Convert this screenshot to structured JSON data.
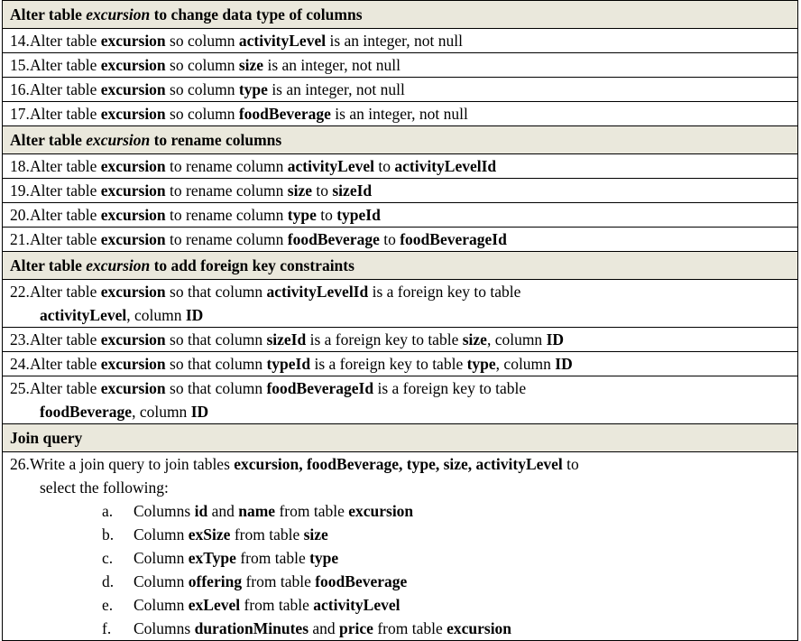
{
  "document": {
    "type": "requirements-table",
    "colors": {
      "section_header_background": "#eae8dc",
      "row_background": "#ffffff",
      "border": "#000000",
      "text": "#000000"
    },
    "sections": [
      {
        "header": {
          "prefix": "Alter table ",
          "italic": "excursion",
          "suffix": " to change data type of columns"
        },
        "items": [
          {
            "number": "14.",
            "lines": [
              [
                {
                  "t": "Alter table ",
                  "b": false
                },
                {
                  "t": "excursion",
                  "b": true
                },
                {
                  "t": " so column ",
                  "b": false
                },
                {
                  "t": "activityLevel",
                  "b": true
                },
                {
                  "t": " is an integer, not null",
                  "b": false
                }
              ]
            ]
          },
          {
            "number": "15.",
            "lines": [
              [
                {
                  "t": "Alter table ",
                  "b": false
                },
                {
                  "t": "excursion",
                  "b": true
                },
                {
                  "t": " so column ",
                  "b": false
                },
                {
                  "t": "size",
                  "b": true
                },
                {
                  "t": " is an integer, not null",
                  "b": false
                }
              ]
            ]
          },
          {
            "number": "16.",
            "lines": [
              [
                {
                  "t": "Alter table ",
                  "b": false
                },
                {
                  "t": "excursion",
                  "b": true
                },
                {
                  "t": " so column ",
                  "b": false
                },
                {
                  "t": "type",
                  "b": true
                },
                {
                  "t": " is an integer, not null",
                  "b": false
                }
              ]
            ]
          },
          {
            "number": "17.",
            "lines": [
              [
                {
                  "t": "Alter table ",
                  "b": false
                },
                {
                  "t": "excursion",
                  "b": true
                },
                {
                  "t": " so column ",
                  "b": false
                },
                {
                  "t": "foodBeverage",
                  "b": true
                },
                {
                  "t": " is an integer, not null",
                  "b": false
                }
              ]
            ]
          }
        ]
      },
      {
        "header": {
          "prefix": "Alter table ",
          "italic": "excursion",
          "suffix": " to rename columns"
        },
        "items": [
          {
            "number": "18.",
            "lines": [
              [
                {
                  "t": "Alter table ",
                  "b": false
                },
                {
                  "t": "excursion",
                  "b": true
                },
                {
                  "t": " to rename column ",
                  "b": false
                },
                {
                  "t": "activityLevel",
                  "b": true
                },
                {
                  "t": " to ",
                  "b": false
                },
                {
                  "t": "activityLevelId",
                  "b": true
                }
              ]
            ]
          },
          {
            "number": "19.",
            "lines": [
              [
                {
                  "t": "Alter table ",
                  "b": false
                },
                {
                  "t": "excursion",
                  "b": true
                },
                {
                  "t": " to rename column ",
                  "b": false
                },
                {
                  "t": "size",
                  "b": true
                },
                {
                  "t": " to ",
                  "b": false
                },
                {
                  "t": "sizeId",
                  "b": true
                }
              ]
            ]
          },
          {
            "number": "20.",
            "lines": [
              [
                {
                  "t": "Alter table ",
                  "b": false
                },
                {
                  "t": "excursion",
                  "b": true
                },
                {
                  "t": " to rename column ",
                  "b": false
                },
                {
                  "t": "type",
                  "b": true
                },
                {
                  "t": " to ",
                  "b": false
                },
                {
                  "t": "typeId",
                  "b": true
                }
              ]
            ]
          },
          {
            "number": "21.",
            "lines": [
              [
                {
                  "t": "Alter table ",
                  "b": false
                },
                {
                  "t": "excursion",
                  "b": true
                },
                {
                  "t": " to rename column ",
                  "b": false
                },
                {
                  "t": "foodBeverage",
                  "b": true
                },
                {
                  "t": " to ",
                  "b": false
                },
                {
                  "t": "foodBeverageId",
                  "b": true
                }
              ]
            ]
          }
        ]
      },
      {
        "header": {
          "prefix": "Alter table ",
          "italic": "excursion",
          "suffix": " to add foreign key constraints"
        },
        "items": [
          {
            "number": "22.",
            "lines": [
              [
                {
                  "t": "Alter table ",
                  "b": false
                },
                {
                  "t": "excursion",
                  "b": true
                },
                {
                  "t": " so that column ",
                  "b": false
                },
                {
                  "t": "activityLevelId",
                  "b": true
                },
                {
                  "t": " is a foreign key to table",
                  "b": false
                }
              ],
              [
                {
                  "t": "activityLevel",
                  "b": true
                },
                {
                  "t": ", column ",
                  "b": false
                },
                {
                  "t": "ID",
                  "b": true
                }
              ]
            ]
          },
          {
            "number": "23.",
            "lines": [
              [
                {
                  "t": "Alter table ",
                  "b": false
                },
                {
                  "t": "excursion",
                  "b": true
                },
                {
                  "t": " so that column ",
                  "b": false
                },
                {
                  "t": "sizeId",
                  "b": true
                },
                {
                  "t": " is a foreign key to table ",
                  "b": false
                },
                {
                  "t": "size",
                  "b": true
                },
                {
                  "t": ", column ",
                  "b": false
                },
                {
                  "t": "ID",
                  "b": true
                }
              ]
            ]
          },
          {
            "number": "24.",
            "lines": [
              [
                {
                  "t": "Alter table ",
                  "b": false
                },
                {
                  "t": "excursion",
                  "b": true
                },
                {
                  "t": " so that column ",
                  "b": false
                },
                {
                  "t": "typeId",
                  "b": true
                },
                {
                  "t": " is a foreign key to table ",
                  "b": false
                },
                {
                  "t": "type",
                  "b": true
                },
                {
                  "t": ", column ",
                  "b": false
                },
                {
                  "t": "ID",
                  "b": true
                }
              ]
            ]
          },
          {
            "number": "25.",
            "lines": [
              [
                {
                  "t": "Alter table ",
                  "b": false
                },
                {
                  "t": "excursion",
                  "b": true
                },
                {
                  "t": " so that column ",
                  "b": false
                },
                {
                  "t": "foodBeverageId",
                  "b": true
                },
                {
                  "t": " is a foreign key to table",
                  "b": false
                }
              ],
              [
                {
                  "t": "foodBeverage",
                  "b": true
                },
                {
                  "t": ", column ",
                  "b": false
                },
                {
                  "t": "ID",
                  "b": true
                }
              ]
            ]
          }
        ]
      },
      {
        "header": {
          "prefix": "Join query",
          "italic": "",
          "suffix": ""
        },
        "items": [
          {
            "number": "26.",
            "lines": [
              [
                {
                  "t": "Write a join query to join tables ",
                  "b": false
                },
                {
                  "t": "excursion, foodBeverage, type, size, activityLevel",
                  "b": true
                },
                {
                  "t": " to",
                  "b": false
                }
              ],
              [
                {
                  "t": "select the following:",
                  "b": false
                }
              ]
            ],
            "sub_items": [
              {
                "letter": "a.",
                "parts": [
                  {
                    "t": "Columns ",
                    "b": false
                  },
                  {
                    "t": "id",
                    "b": true
                  },
                  {
                    "t": " and ",
                    "b": false
                  },
                  {
                    "t": "name",
                    "b": true
                  },
                  {
                    "t": " from table ",
                    "b": false
                  },
                  {
                    "t": "excursion",
                    "b": true
                  }
                ]
              },
              {
                "letter": "b.",
                "parts": [
                  {
                    "t": "Column ",
                    "b": false
                  },
                  {
                    "t": "exSize",
                    "b": true
                  },
                  {
                    "t": " from table ",
                    "b": false
                  },
                  {
                    "t": "size",
                    "b": true
                  }
                ]
              },
              {
                "letter": "c.",
                "parts": [
                  {
                    "t": "Column ",
                    "b": false
                  },
                  {
                    "t": "exType",
                    "b": true
                  },
                  {
                    "t": " from table ",
                    "b": false
                  },
                  {
                    "t": "type",
                    "b": true
                  }
                ]
              },
              {
                "letter": "d.",
                "parts": [
                  {
                    "t": "Column ",
                    "b": false
                  },
                  {
                    "t": "offering",
                    "b": true
                  },
                  {
                    "t": " from table ",
                    "b": false
                  },
                  {
                    "t": "foodBeverage",
                    "b": true
                  }
                ]
              },
              {
                "letter": "e.",
                "parts": [
                  {
                    "t": "Column ",
                    "b": false
                  },
                  {
                    "t": "exLevel",
                    "b": true
                  },
                  {
                    "t": " from table ",
                    "b": false
                  },
                  {
                    "t": "activityLevel",
                    "b": true
                  }
                ]
              },
              {
                "letter": "f.",
                "parts": [
                  {
                    "t": "Columns ",
                    "b": false
                  },
                  {
                    "t": "durationMinutes",
                    "b": true
                  },
                  {
                    "t": " and ",
                    "b": false
                  },
                  {
                    "t": "price",
                    "b": true
                  },
                  {
                    "t": " from table ",
                    "b": false
                  },
                  {
                    "t": "excursion",
                    "b": true
                  }
                ]
              }
            ]
          }
        ]
      }
    ]
  }
}
